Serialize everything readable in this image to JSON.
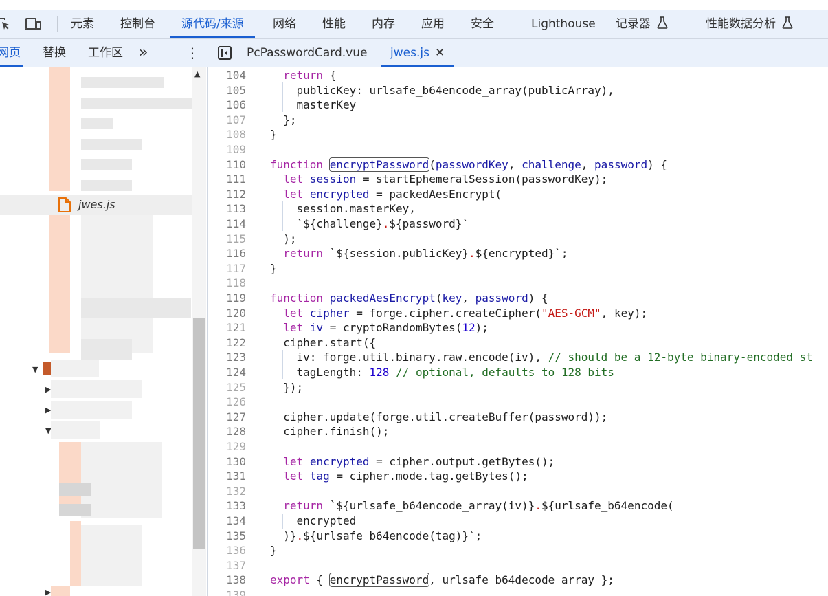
{
  "colors": {
    "accent": "#1a5fd1",
    "toolbar_bg": "#eaf1fb",
    "keyword": "#a626a4",
    "variable": "#1a1aa6",
    "string": "#c41a16",
    "number": "#1c00cf",
    "comment": "#236e25",
    "line_number": "#7a7a7a"
  },
  "toolbar": {
    "icons": [
      "inspect-element-icon",
      "device-toolbar-icon"
    ],
    "tabs": [
      {
        "label": "元素"
      },
      {
        "label": "控制台"
      },
      {
        "label": "源代码/来源",
        "active": true
      },
      {
        "label": "网络"
      },
      {
        "label": "性能"
      },
      {
        "label": "内存"
      },
      {
        "label": "应用"
      },
      {
        "label": "安全"
      },
      {
        "label": "Lighthouse"
      },
      {
        "label": "记录器",
        "icon": "flask-icon"
      },
      {
        "label": "性能数据分析",
        "icon": "flask-icon"
      }
    ]
  },
  "subbar": {
    "tabs": [
      {
        "label": "网页",
        "active": true
      },
      {
        "label": "替换"
      },
      {
        "label": "工作区"
      }
    ],
    "more": "»",
    "menu": "⋮",
    "files": [
      {
        "label": "PcPasswordCard.vue"
      },
      {
        "label": "jwes.js",
        "active": true,
        "close": "✕"
      }
    ]
  },
  "navigator": {
    "selected_file": "jwes.js"
  },
  "editor": {
    "lines": [
      {
        "n": "104",
        "t": [
          [
            "  ",
            ""
          ],
          [
            "return",
            "k"
          ],
          [
            " {",
            ""
          ]
        ]
      },
      {
        "n": "105",
        "t": [
          [
            "    publicKey: urlsafe_b64encode_array(publicArray),",
            ""
          ]
        ]
      },
      {
        "n": "106",
        "t": [
          [
            "    masterKey",
            ""
          ]
        ]
      },
      {
        "n": "107",
        "t": [
          [
            "  };",
            ""
          ]
        ],
        "faint": true
      },
      {
        "n": "108",
        "t": [
          [
            "}",
            ""
          ]
        ],
        "faint": true
      },
      {
        "n": "109",
        "t": [],
        "faint": true
      },
      {
        "n": "110",
        "t": [
          [
            "function",
            "k"
          ],
          [
            " ",
            ""
          ],
          [
            "encryptPassword",
            "k2 hl"
          ],
          [
            "(",
            ""
          ],
          [
            "passwordKey",
            "v"
          ],
          [
            ", ",
            ""
          ],
          [
            "challenge",
            "v"
          ],
          [
            ", ",
            ""
          ],
          [
            "password",
            "v"
          ],
          [
            ") {",
            ""
          ]
        ]
      },
      {
        "n": "111",
        "t": [
          [
            "  ",
            ""
          ],
          [
            "let",
            "k"
          ],
          [
            " ",
            ""
          ],
          [
            "session",
            "v"
          ],
          [
            " = startEphemeralSession(passwordKey);",
            ""
          ]
        ]
      },
      {
        "n": "112",
        "t": [
          [
            "  ",
            ""
          ],
          [
            "let",
            "k"
          ],
          [
            " ",
            ""
          ],
          [
            "encrypted",
            "v"
          ],
          [
            " = packedAesEncrypt(",
            ""
          ]
        ]
      },
      {
        "n": "113",
        "t": [
          [
            "    session.masterKey,",
            ""
          ]
        ]
      },
      {
        "n": "114",
        "t": [
          [
            "    `${challenge}",
            ""
          ],
          [
            ".",
            "s"
          ],
          [
            "${password}`",
            ""
          ]
        ]
      },
      {
        "n": "115",
        "t": [
          [
            "  );",
            ""
          ]
        ],
        "faint": true
      },
      {
        "n": "116",
        "t": [
          [
            "  ",
            ""
          ],
          [
            "return",
            "k"
          ],
          [
            " `${session.publicKey}",
            ""
          ],
          [
            ".",
            "s"
          ],
          [
            "${encrypted}`;",
            ""
          ]
        ]
      },
      {
        "n": "117",
        "t": [
          [
            "}",
            ""
          ]
        ],
        "faint": true
      },
      {
        "n": "118",
        "t": [],
        "faint": true
      },
      {
        "n": "119",
        "t": [
          [
            "function",
            "k"
          ],
          [
            " ",
            ""
          ],
          [
            "packedAesEncrypt",
            "k2"
          ],
          [
            "(",
            ""
          ],
          [
            "key",
            "v"
          ],
          [
            ", ",
            ""
          ],
          [
            "password",
            "v"
          ],
          [
            ") {",
            ""
          ]
        ]
      },
      {
        "n": "120",
        "t": [
          [
            "  ",
            ""
          ],
          [
            "let",
            "k"
          ],
          [
            " ",
            ""
          ],
          [
            "cipher",
            "v"
          ],
          [
            " = forge.cipher.createCipher(",
            ""
          ],
          [
            "\"AES-GCM\"",
            "s"
          ],
          [
            ", key);",
            ""
          ]
        ]
      },
      {
        "n": "121",
        "t": [
          [
            "  ",
            ""
          ],
          [
            "let",
            "k"
          ],
          [
            " ",
            ""
          ],
          [
            "iv",
            "v"
          ],
          [
            " = cryptoRandomBytes(",
            ""
          ],
          [
            "12",
            "n"
          ],
          [
            ");",
            ""
          ]
        ]
      },
      {
        "n": "122",
        "t": [
          [
            "  cipher.start({",
            ""
          ]
        ]
      },
      {
        "n": "123",
        "t": [
          [
            "    iv: forge.util.binary.raw.encode(iv), ",
            ""
          ],
          [
            "// should be a 12-byte binary-encoded st",
            "c"
          ]
        ]
      },
      {
        "n": "124",
        "t": [
          [
            "    tagLength: ",
            ""
          ],
          [
            "128",
            "n"
          ],
          [
            " ",
            ""
          ],
          [
            "// optional, defaults to 128 bits",
            "c"
          ]
        ]
      },
      {
        "n": "125",
        "t": [
          [
            "  });",
            ""
          ]
        ],
        "faint": true
      },
      {
        "n": "126",
        "t": [],
        "faint": true
      },
      {
        "n": "127",
        "t": [
          [
            "  cipher.update(forge.util.createBuffer(password));",
            ""
          ]
        ]
      },
      {
        "n": "128",
        "t": [
          [
            "  cipher.finish();",
            ""
          ]
        ]
      },
      {
        "n": "129",
        "t": [],
        "faint": true
      },
      {
        "n": "130",
        "t": [
          [
            "  ",
            ""
          ],
          [
            "let",
            "k"
          ],
          [
            " ",
            ""
          ],
          [
            "encrypted",
            "v"
          ],
          [
            " = cipher.output.getBytes();",
            ""
          ]
        ]
      },
      {
        "n": "131",
        "t": [
          [
            "  ",
            ""
          ],
          [
            "let",
            "k"
          ],
          [
            " ",
            ""
          ],
          [
            "tag",
            "v"
          ],
          [
            " = cipher.mode.tag.getBytes();",
            ""
          ]
        ]
      },
      {
        "n": "132",
        "t": [],
        "faint": true
      },
      {
        "n": "133",
        "t": [
          [
            "  ",
            ""
          ],
          [
            "return",
            "k"
          ],
          [
            " `${urlsafe_b64encode_array(iv)}",
            ""
          ],
          [
            ".",
            "s"
          ],
          [
            "${urlsafe_b64encode(",
            ""
          ]
        ]
      },
      {
        "n": "134",
        "t": [
          [
            "    encrypted",
            ""
          ]
        ]
      },
      {
        "n": "135",
        "t": [
          [
            "  )}",
            ""
          ],
          [
            ".",
            "s"
          ],
          [
            "${urlsafe_b64encode(tag)}`;",
            ""
          ]
        ]
      },
      {
        "n": "136",
        "t": [
          [
            "}",
            ""
          ]
        ],
        "faint": true
      },
      {
        "n": "137",
        "t": [],
        "faint": true
      },
      {
        "n": "138",
        "t": [
          [
            "export",
            "k"
          ],
          [
            " { ",
            ""
          ],
          [
            "encryptPassword",
            "hl"
          ],
          [
            ", urlsafe_b64decode_array };",
            ""
          ]
        ]
      },
      {
        "n": "139",
        "t": [],
        "faint": true
      }
    ]
  }
}
